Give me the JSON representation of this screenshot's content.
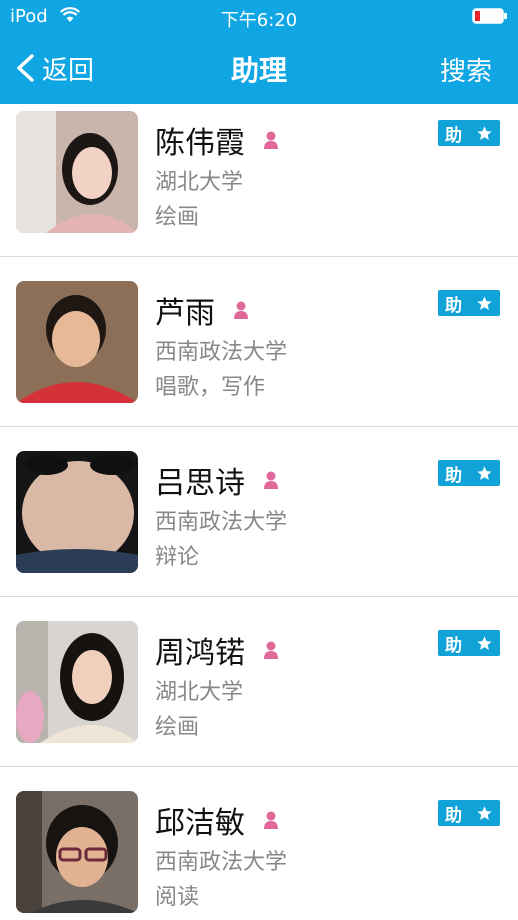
{
  "status_bar": {
    "carrier": "iPod",
    "time": "下午6:20"
  },
  "nav": {
    "back_label": "返回",
    "title": "助理",
    "search_label": "搜索"
  },
  "contacts": [
    {
      "name": "陈伟霞",
      "school": "湖北大学",
      "hobby": "绘画",
      "badge": "助"
    },
    {
      "name": "芦雨",
      "school": "西南政法大学",
      "hobby": "唱歌，写作",
      "badge": "助"
    },
    {
      "name": "吕思诗",
      "school": "西南政法大学",
      "hobby": "辩论",
      "badge": "助"
    },
    {
      "name": "周鸿锘",
      "school": "湖北大学",
      "hobby": "绘画",
      "badge": "助"
    },
    {
      "name": "邱洁敏",
      "school": "西南政法大学",
      "hobby": "阅读",
      "badge": "助"
    }
  ],
  "colors": {
    "header": "#10a6e3",
    "badge": "#11a3d8",
    "gender": "#e0699a",
    "secondary_text": "#888888"
  },
  "icons": [
    "back-chevron-icon",
    "wifi-icon",
    "battery-icon",
    "gender-female-icon",
    "star-icon"
  ]
}
